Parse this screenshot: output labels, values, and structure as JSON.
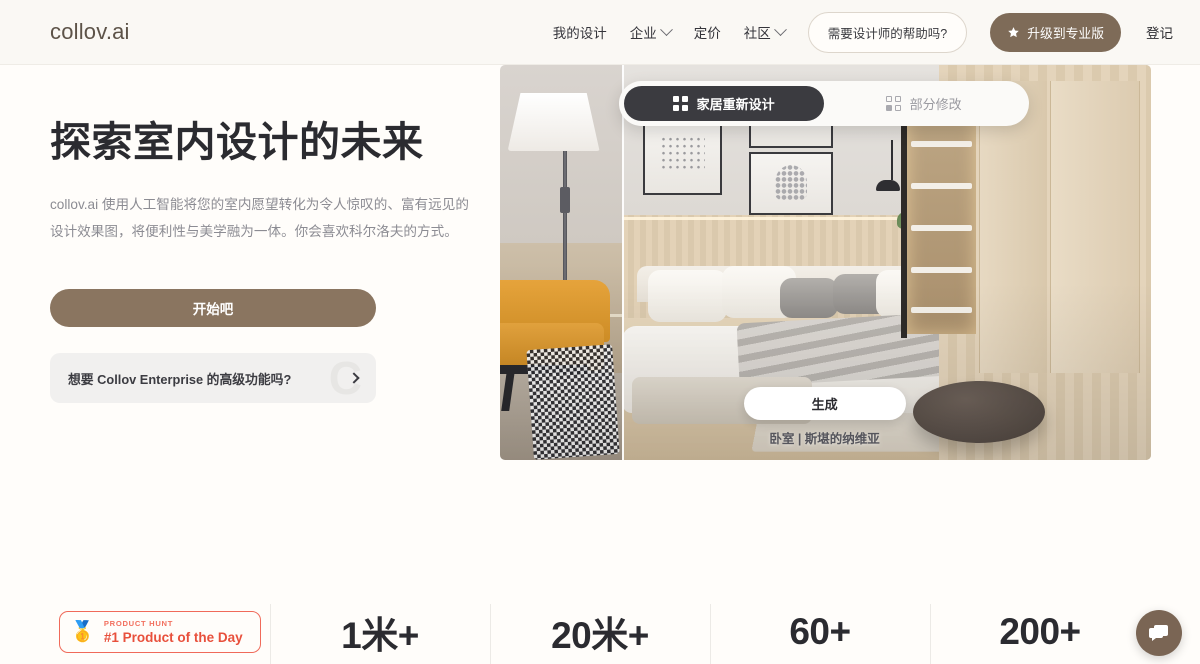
{
  "header": {
    "brand": "collov.ai",
    "nav": [
      {
        "label": "我的设计",
        "has_caret": false
      },
      {
        "label": "企业",
        "has_caret": true
      },
      {
        "label": "定价",
        "has_caret": false
      },
      {
        "label": "社区",
        "has_caret": true
      }
    ],
    "help_button": "需要设计师的帮助吗?",
    "pro_button": "升级到专业版",
    "pro_icon": "star-icon",
    "login": "登记"
  },
  "hero": {
    "title": "探索室内设计的未来",
    "subtitle": "collov.ai 使用人工智能将您的室内愿望转化为令人惊叹的、富有远见的设计效果图，将便利性与美学融为一体。你会喜欢科尔洛夫的方式。",
    "start_button": "开始吧",
    "enterprise_card": {
      "text": "想要 Collov Enterprise 的高级功能吗?",
      "chevron": "chevron-right-icon",
      "watermark": "C"
    }
  },
  "showcase": {
    "tabs": [
      {
        "label": "家居重新设计",
        "icon": "grid-filled-icon",
        "active": true
      },
      {
        "label": "部分修改",
        "icon": "grid-outline-icon",
        "active": false
      }
    ],
    "generate_button": "生成",
    "caption": "卧室 | 斯堪的纳维亚"
  },
  "stats": {
    "product_hunt": {
      "kicker": "PRODUCT HUNT",
      "title": "#1 Product of the Day",
      "medal": "🥇"
    },
    "items": [
      {
        "value": "1米+"
      },
      {
        "value": "20米+"
      },
      {
        "value": "60+"
      },
      {
        "value": "200+"
      }
    ]
  },
  "chat": {
    "icon": "chat-bubble-icon",
    "color": "#7a6554"
  },
  "colors": {
    "accent_brown": "#7e6b58",
    "cta_brown": "#8a7560",
    "page_bg": "#fffdfa",
    "header_bg": "#faf8f4",
    "product_hunt_red": "#e8503c"
  }
}
